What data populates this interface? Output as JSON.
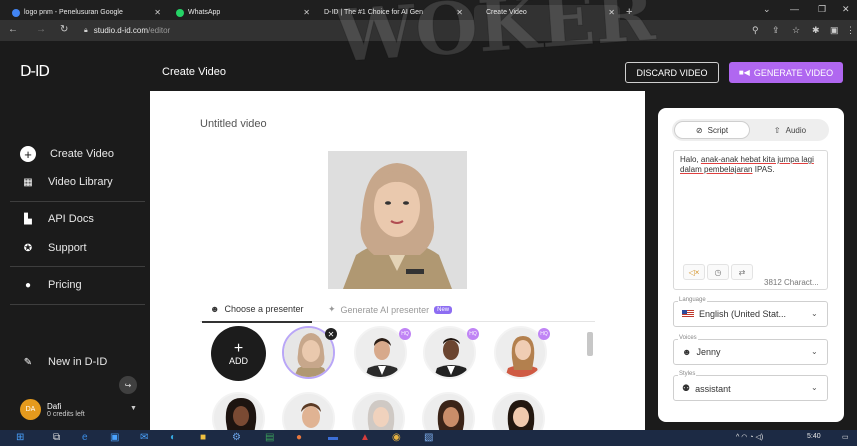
{
  "browser": {
    "tabs": [
      {
        "title": "logo pnm - Penelusuran Google",
        "favicon_color": "#4285f4"
      },
      {
        "title": "WhatsApp",
        "favicon_color": "#25d366"
      },
      {
        "title": "D-ID | The #1 Choice for AI Gen",
        "favicon_color": "#333333"
      },
      {
        "title": "Create Video",
        "favicon_color": "#111111"
      }
    ],
    "url_host": "studio.d-id.com",
    "url_path": "/editor"
  },
  "app": {
    "logo": "D-ID",
    "page_title": "Create Video",
    "discard_label": "DISCARD VIDEO",
    "generate_label": "GENERATE VIDEO",
    "accent_color": "#b067f0"
  },
  "sidebar": {
    "items": [
      {
        "label": "Create Video",
        "icon": "plus-circle-icon"
      },
      {
        "label": "Video Library",
        "icon": "grid-icon"
      },
      {
        "label": "API Docs",
        "icon": "document-icon"
      },
      {
        "label": "Support",
        "icon": "support-icon"
      },
      {
        "label": "Pricing",
        "icon": "pricing-icon"
      },
      {
        "label": "New in D-ID",
        "icon": "megaphone-icon"
      }
    ],
    "user": {
      "initials": "DA",
      "name": "Dafi",
      "credits": "0 credits left"
    }
  },
  "editor": {
    "video_title": "Untitled video",
    "presenter_tabs": {
      "choose": "Choose a presenter",
      "generate": "Generate AI presenter",
      "new_badge": "New"
    },
    "add_label": "ADD",
    "hq_badge": "HQ"
  },
  "panel": {
    "script_tab": "Script",
    "audio_tab": "Audio",
    "script_text_1": "Halo, ",
    "script_text_link": "anak-anak hebat kita jumpa lagi dalam pembelajaran",
    "script_text_2": " IPAS.",
    "char_count": "3812 Charact...",
    "language": {
      "label": "Language",
      "value": "English (United Stat..."
    },
    "voices": {
      "label": "Voices",
      "value": "Jenny"
    },
    "styles": {
      "label": "Styles",
      "value": "assistant"
    }
  },
  "taskbar": {
    "time": "5:40"
  },
  "watermark": "WOKER"
}
